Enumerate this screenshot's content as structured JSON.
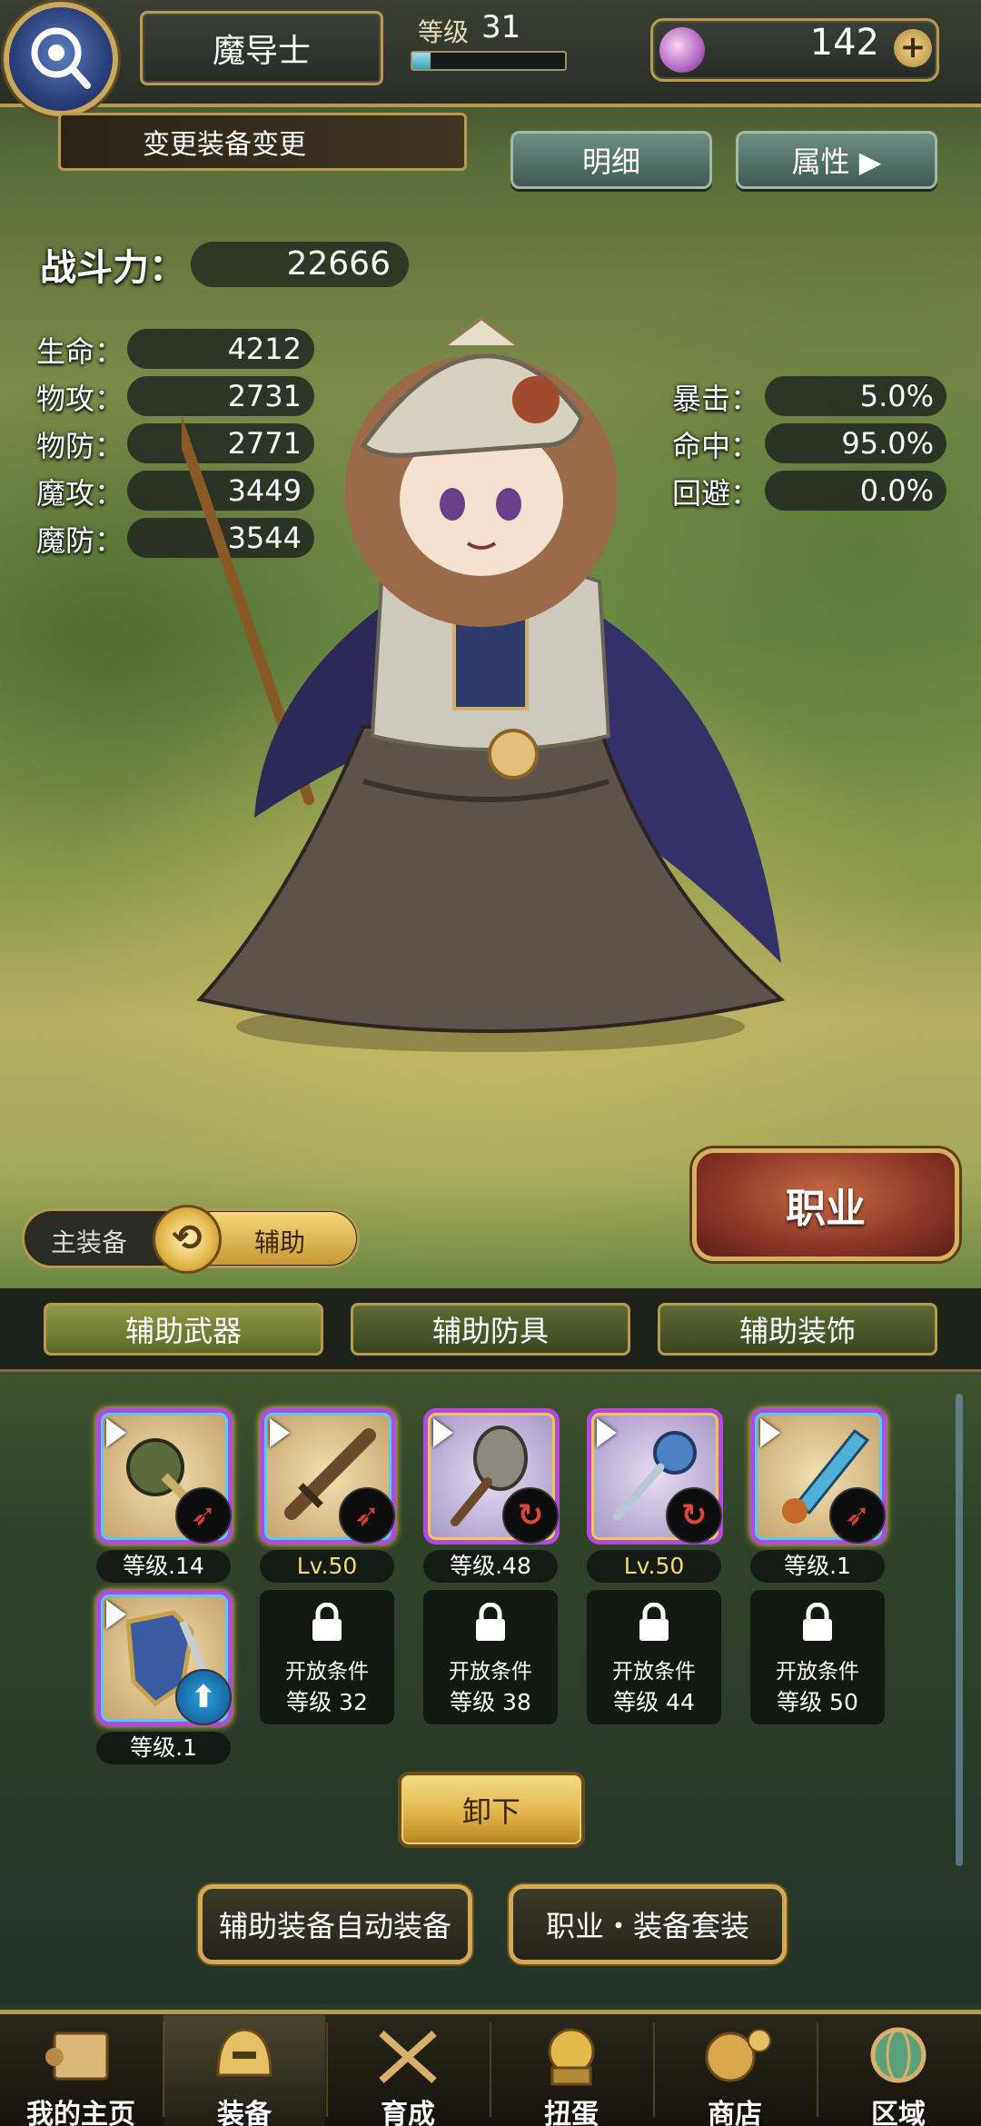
{
  "header": {
    "job_name": "魔导士",
    "level_label": "等级",
    "level": "31",
    "level_progress": 0.12,
    "gems": "142",
    "gem_add": "+"
  },
  "preset": {
    "label": "变更装备变更"
  },
  "buttons": {
    "detail": "明细",
    "attributes": "属性 ▶",
    "job": "职业",
    "unequip": "卸下",
    "auto_equip": "辅助装备自动装备",
    "job_set": "职业・装备套装"
  },
  "power": {
    "label": "战斗力：",
    "value": "22666"
  },
  "stats_left": [
    {
      "label": "生命：",
      "value": "4212"
    },
    {
      "label": "物攻：",
      "value": "2731"
    },
    {
      "label": "物防：",
      "value": "2771"
    },
    {
      "label": "魔攻：",
      "value": "3449"
    },
    {
      "label": "魔防：",
      "value": "3544"
    }
  ],
  "stats_right": [
    {
      "label": "暴击：",
      "value": "5.0%"
    },
    {
      "label": "命中：",
      "value": "95.0%"
    },
    {
      "label": "回避：",
      "value": "0.0%"
    }
  ],
  "toggle": {
    "main": "主装备",
    "aux": "辅助"
  },
  "tabs": [
    {
      "label": "辅助武器"
    },
    {
      "label": "辅助防具"
    },
    {
      "label": "辅助装饰"
    }
  ],
  "equipment": [
    {
      "level": "等级.14",
      "icon": "mace-icon",
      "badge": "fire"
    },
    {
      "level": "Lv.50",
      "icon": "sword-icon",
      "badge": "fire"
    },
    {
      "level": "等级.48",
      "icon": "club-icon",
      "badge": "swirl"
    },
    {
      "level": "Lv.50",
      "icon": "morning-star-icon",
      "badge": "swirl"
    },
    {
      "level": "等级.1",
      "icon": "crystal-blade-icon",
      "badge": "fire"
    },
    {
      "level": "等级.1",
      "icon": "shield-sword-icon",
      "badge": "up"
    }
  ],
  "locked_slots": [
    {
      "line1": "开放条件",
      "line2": "等级 32"
    },
    {
      "line1": "开放条件",
      "line2": "等级 38"
    },
    {
      "line1": "开放条件",
      "line2": "等级 44"
    },
    {
      "line1": "开放条件",
      "line2": "等级 50"
    }
  ],
  "nav": [
    {
      "label": "我的主页",
      "icon": "scroll-icon"
    },
    {
      "label": "装备",
      "icon": "helmet-icon"
    },
    {
      "label": "育成",
      "icon": "swords-icon"
    },
    {
      "label": "扭蛋",
      "icon": "gacha-icon"
    },
    {
      "label": "商店",
      "icon": "coin-icon"
    },
    {
      "label": "区域",
      "icon": "globe-icon"
    }
  ],
  "colors": {
    "gold_border": "#b59a52",
    "job_button": "#8a3626",
    "rarity_purple": "#b04ae0"
  }
}
